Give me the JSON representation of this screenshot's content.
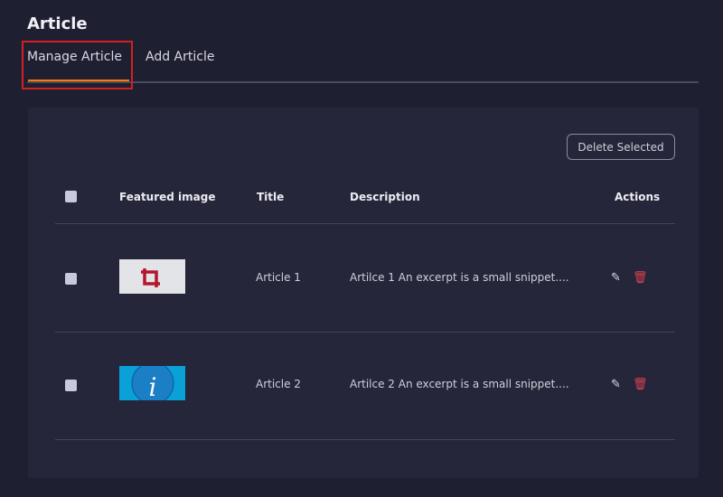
{
  "page": {
    "title": "Article"
  },
  "tabs": [
    {
      "label": "Manage Article",
      "active": true
    },
    {
      "label": "Add Article"
    }
  ],
  "toolbar": {
    "delete_selected": "Delete Selected"
  },
  "table": {
    "headers": [
      "Featured image",
      "Title",
      "Description",
      "Actions"
    ],
    "rows": [
      {
        "image": "crop-icon-thumbnail",
        "title": "Article 1",
        "description": "Artilce 1  An excerpt is a small snippet...."
      },
      {
        "image": "info-icon-thumbnail",
        "title": "Article 2",
        "description": "Artilce 2 An excerpt is a small snippet...."
      }
    ]
  },
  "colors": {
    "accent": "#ff7a00",
    "highlight": "#d4201f"
  }
}
